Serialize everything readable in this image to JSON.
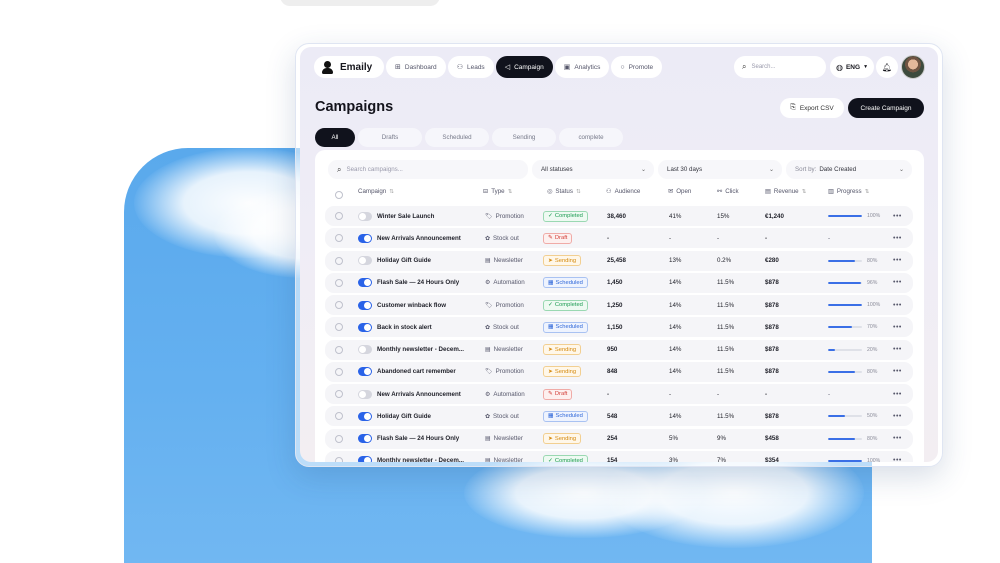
{
  "app": {
    "name": "Emaily"
  },
  "nav": [
    {
      "label": "Dashboard",
      "icon": "grid-icon",
      "glyph": "⊞",
      "active": false
    },
    {
      "label": "Leads",
      "icon": "users-icon",
      "glyph": "⚇",
      "active": false
    },
    {
      "label": "Campaign",
      "icon": "megaphone-icon",
      "glyph": "◁",
      "active": true
    },
    {
      "label": "Analytics",
      "icon": "chart-icon",
      "glyph": "▣",
      "active": false
    },
    {
      "label": "Promote",
      "icon": "target-icon",
      "glyph": "○",
      "active": false
    }
  ],
  "header": {
    "search_placeholder": "Search...",
    "language": "ENG"
  },
  "page": {
    "title": "Campaigns",
    "export_label": "Export CSV",
    "create_label": "Create Campaign"
  },
  "tabs": [
    {
      "label": "All",
      "active": true
    },
    {
      "label": "Drafts",
      "active": false
    },
    {
      "label": "Scheduled",
      "active": false
    },
    {
      "label": "Sending",
      "active": false
    },
    {
      "label": "complete",
      "active": false
    }
  ],
  "filters": {
    "search_placeholder": "Search campaigns...",
    "status": "All statuses",
    "range": "Last 30 days",
    "sort_prefix": "Sort by:",
    "sort_value": "Date Created"
  },
  "columns": {
    "campaign": "Campaign",
    "type": "Type",
    "status": "Status",
    "audience": "Audience",
    "open": "Open",
    "click": "Click",
    "revenue": "Revenue",
    "progress": "Progress"
  },
  "type_icons": {
    "Promotion": "🏷",
    "Stock out": "✿",
    "Newsletter": "▤",
    "Automation": "⚙"
  },
  "status_icons": {
    "Completed": "✓",
    "Draft": "✎",
    "Sending": "➤",
    "Scheduled": "▦"
  },
  "rows": [
    {
      "name": "Winter Sale Launch",
      "enabled": false,
      "type": "Promotion",
      "status": "Completed",
      "audience": "38,460",
      "open": "41%",
      "click": "15%",
      "revenue": "€1,240",
      "progress": 100,
      "progress_label": "100%"
    },
    {
      "name": "New Arrivals Announcement",
      "enabled": true,
      "type": "Stock out",
      "status": "Draft",
      "audience": "-",
      "open": "-",
      "click": "-",
      "revenue": "-",
      "progress": null,
      "progress_label": "-"
    },
    {
      "name": "Holiday Gift Guide",
      "enabled": false,
      "type": "Newsletter",
      "status": "Sending",
      "audience": "25,458",
      "open": "13%",
      "click": "0.2%",
      "revenue": "€280",
      "progress": 80,
      "progress_label": "80%"
    },
    {
      "name": "Flash Sale — 24 Hours Only",
      "enabled": true,
      "type": "Automation",
      "status": "Scheduled",
      "audience": "1,450",
      "open": "14%",
      "click": "11.5%",
      "revenue": "$878",
      "progress": 96,
      "progress_label": "96%"
    },
    {
      "name": "Customer winback flow",
      "enabled": true,
      "type": "Promotion",
      "status": "Completed",
      "audience": "1,250",
      "open": "14%",
      "click": "11.5%",
      "revenue": "$878",
      "progress": 100,
      "progress_label": "100%"
    },
    {
      "name": "Back in stock alert",
      "enabled": true,
      "type": "Stock out",
      "status": "Scheduled",
      "audience": "1,150",
      "open": "14%",
      "click": "11.5%",
      "revenue": "$878",
      "progress": 70,
      "progress_label": "70%"
    },
    {
      "name": "Monthly newsletter - Decem...",
      "enabled": false,
      "type": "Newsletter",
      "status": "Sending",
      "audience": "950",
      "open": "14%",
      "click": "11.5%",
      "revenue": "$878",
      "progress": 20,
      "progress_label": "20%"
    },
    {
      "name": "Abandoned cart remember",
      "enabled": true,
      "type": "Promotion",
      "status": "Sending",
      "audience": "848",
      "open": "14%",
      "click": "11.5%",
      "revenue": "$878",
      "progress": 80,
      "progress_label": "80%"
    },
    {
      "name": "New Arrivals Announcement",
      "enabled": false,
      "type": "Automation",
      "status": "Draft",
      "audience": "-",
      "open": "-",
      "click": "-",
      "revenue": "-",
      "progress": null,
      "progress_label": "-"
    },
    {
      "name": "Holiday Gift Guide",
      "enabled": true,
      "type": "Stock out",
      "status": "Scheduled",
      "audience": "548",
      "open": "14%",
      "click": "11.5%",
      "revenue": "$878",
      "progress": 50,
      "progress_label": "50%"
    },
    {
      "name": "Flash Sale — 24 Hours Only",
      "enabled": true,
      "type": "Newsletter",
      "status": "Sending",
      "audience": "254",
      "open": "5%",
      "click": "9%",
      "revenue": "$458",
      "progress": 80,
      "progress_label": "80%"
    },
    {
      "name": "Monthly newsletter - Decem...",
      "enabled": true,
      "type": "Newsletter",
      "status": "Completed",
      "audience": "154",
      "open": "3%",
      "click": "7%",
      "revenue": "$354",
      "progress": 100,
      "progress_label": "100%"
    }
  ]
}
